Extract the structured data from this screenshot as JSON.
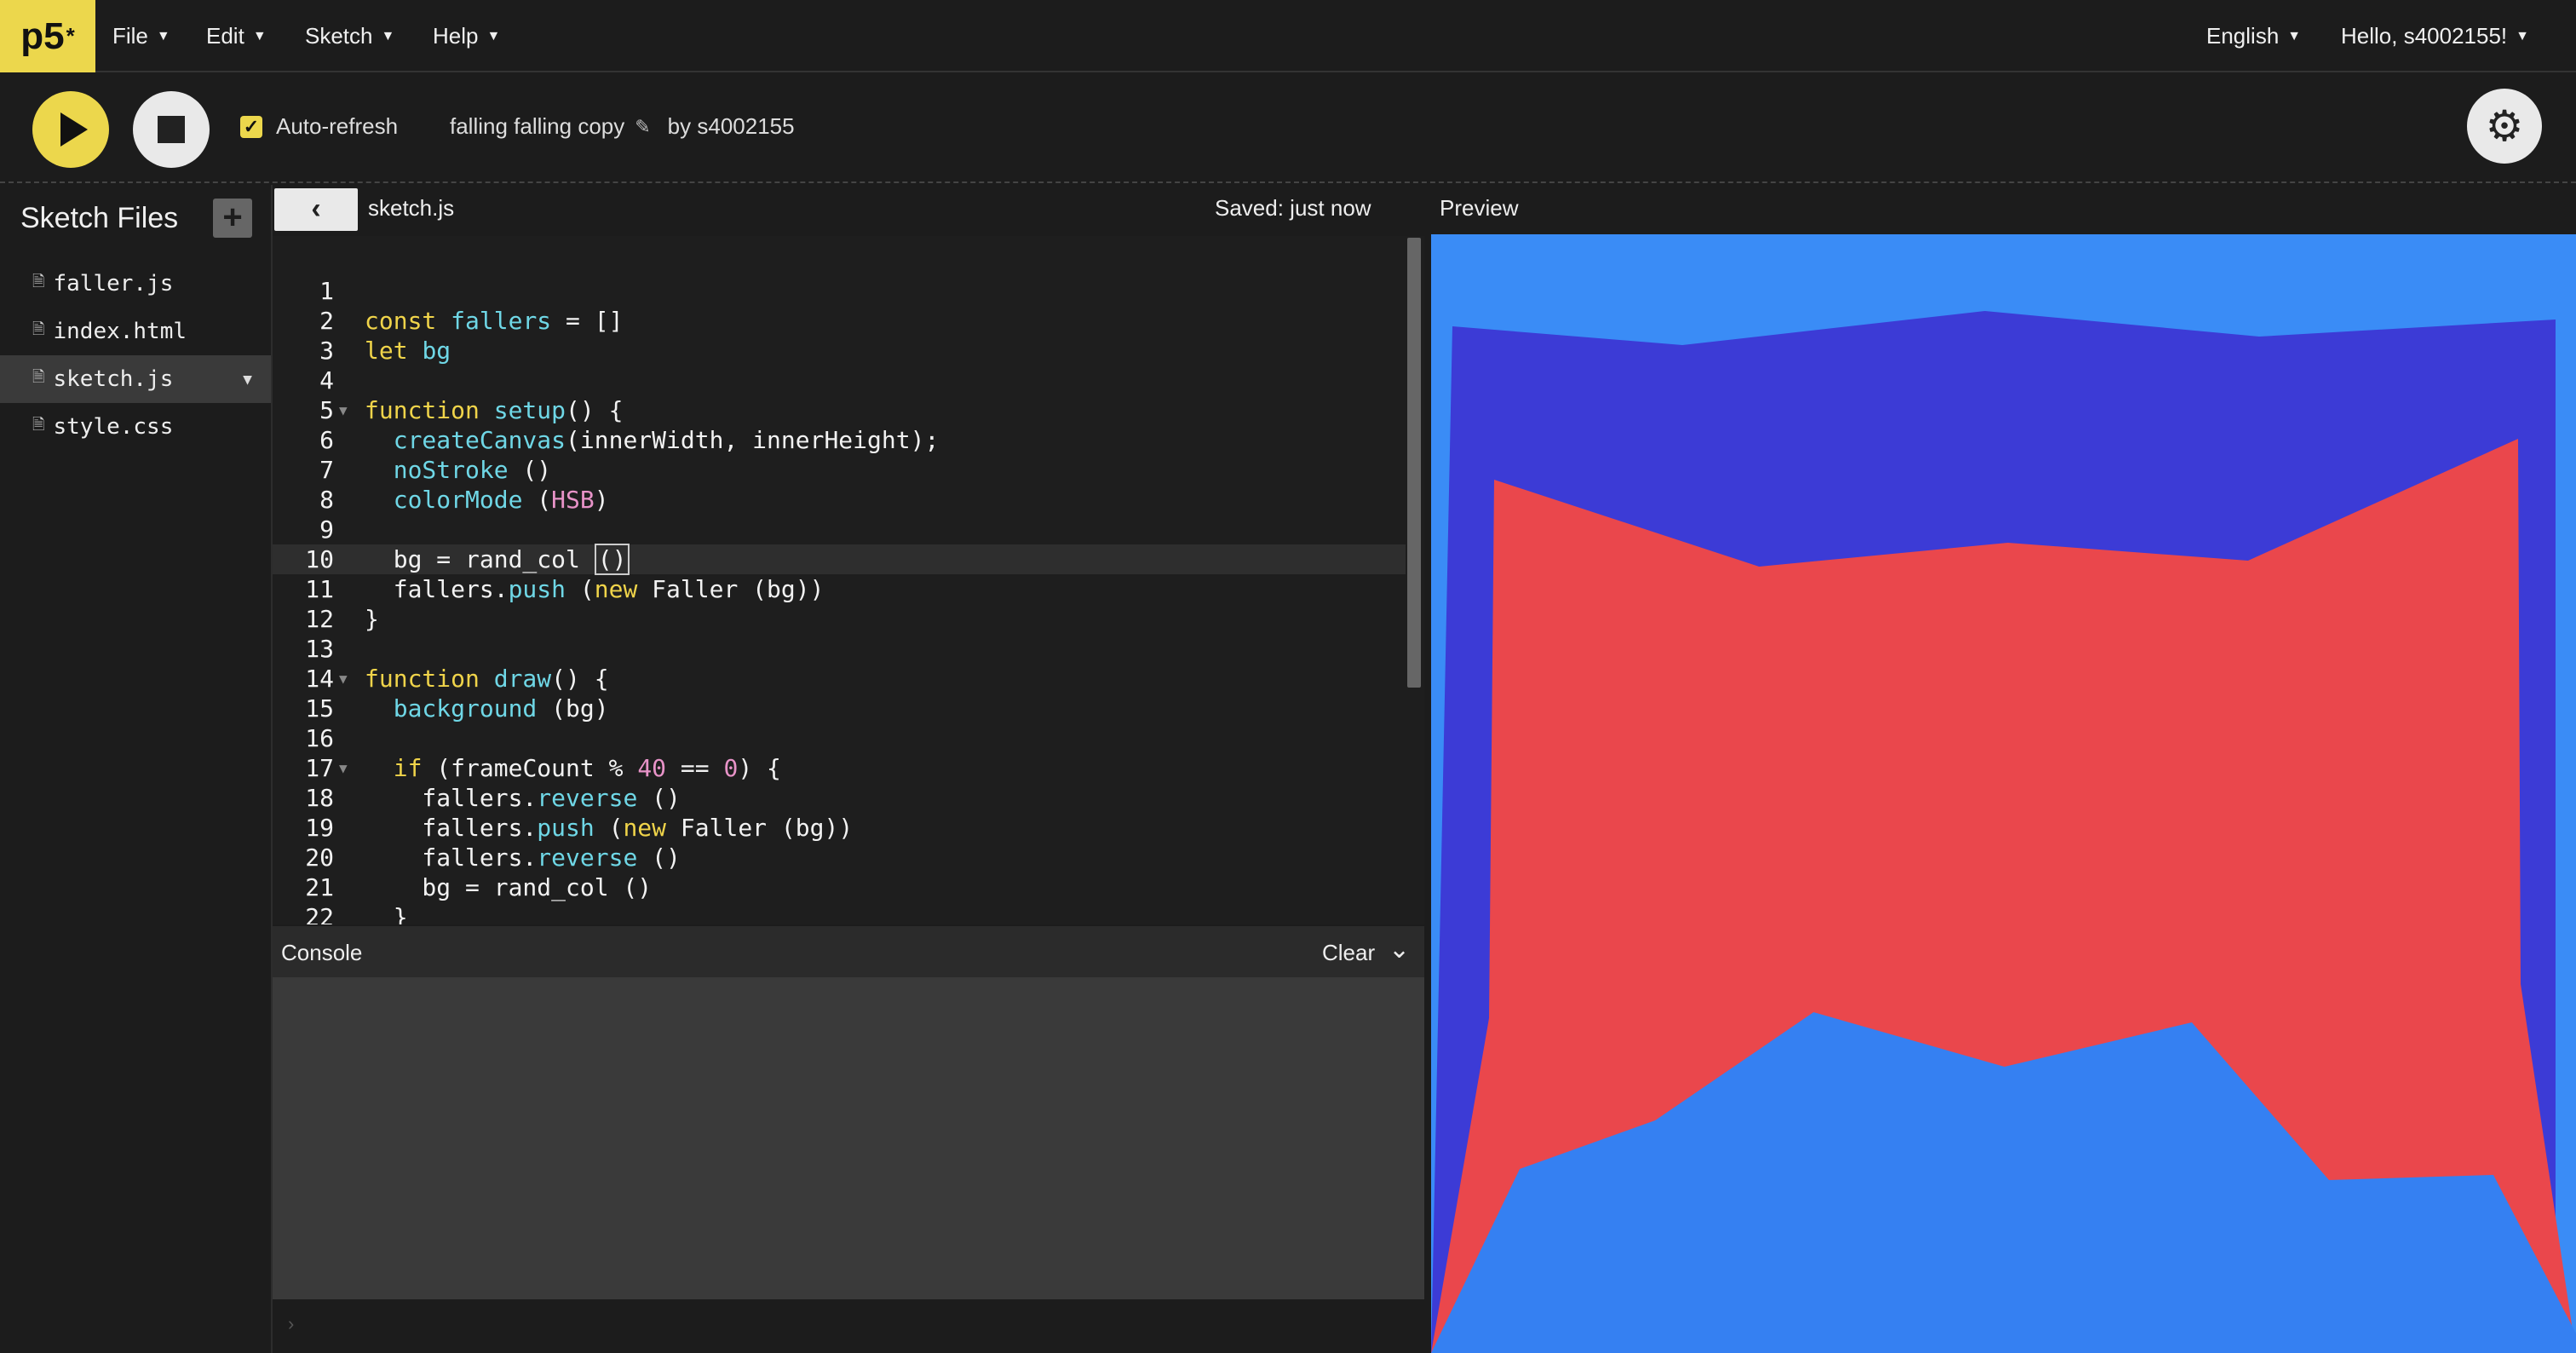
{
  "app": {
    "logo": "p5",
    "logo_sup": "*"
  },
  "menu": {
    "file": "File",
    "edit": "Edit",
    "sketch": "Sketch",
    "help": "Help",
    "language": "English",
    "user": "Hello, s4002155!"
  },
  "toolbar": {
    "auto_refresh_label": "Auto-refresh",
    "auto_refresh_checked": true,
    "sketch_name": "falling falling copy",
    "author": "by s4002155"
  },
  "sidebar": {
    "title": "Sketch Files",
    "add_label": "+",
    "files": [
      {
        "name": "faller.js"
      },
      {
        "name": "index.html"
      },
      {
        "name": "sketch.js",
        "active": true
      },
      {
        "name": "style.css"
      }
    ]
  },
  "editor": {
    "filename": "sketch.js",
    "saved_status": "Saved: just now",
    "current_line": 10,
    "lines": [
      {
        "n": "1",
        "code": ""
      },
      {
        "n": "2",
        "code": "const fallers = []"
      },
      {
        "n": "3",
        "code": "let bg"
      },
      {
        "n": "4",
        "code": ""
      },
      {
        "n": "5",
        "code": "function setup() {"
      },
      {
        "n": "6",
        "code": "  createCanvas(innerWidth, innerHeight);"
      },
      {
        "n": "7",
        "code": "  noStroke ()"
      },
      {
        "n": "8",
        "code": "  colorMode (HSB)"
      },
      {
        "n": "9",
        "code": ""
      },
      {
        "n": "10",
        "code": "  bg = rand_col ()"
      },
      {
        "n": "11",
        "code": "  fallers.push (new Faller (bg))"
      },
      {
        "n": "12",
        "code": "}"
      },
      {
        "n": "13",
        "code": ""
      },
      {
        "n": "14",
        "code": "function draw() {"
      },
      {
        "n": "15",
        "code": "  background (bg)"
      },
      {
        "n": "16",
        "code": ""
      },
      {
        "n": "17",
        "code": "  if (frameCount % 40 == 0) {"
      },
      {
        "n": "18",
        "code": "    fallers.reverse ()"
      },
      {
        "n": "19",
        "code": "    fallers.push (new Faller (bg))"
      },
      {
        "n": "20",
        "code": "    fallers.reverse ()"
      },
      {
        "n": "21",
        "code": "    bg = rand_col ()"
      },
      {
        "n": "22",
        "code": "  }"
      }
    ]
  },
  "console": {
    "title": "Console",
    "clear_label": "Clear",
    "prompt": "›"
  },
  "preview": {
    "label": "Preview",
    "colors": {
      "background": "#3a8cf6",
      "violet": "#3c3bd6",
      "red": "#ea474c",
      "blue": "#3580f2"
    }
  },
  "icons": {
    "play": "play-icon",
    "stop": "stop-icon",
    "settings": "gear-icon",
    "pencil": "pencil-icon",
    "file": "file-icon",
    "caret": "chevron-down-icon",
    "back": "chevron-left-icon"
  }
}
